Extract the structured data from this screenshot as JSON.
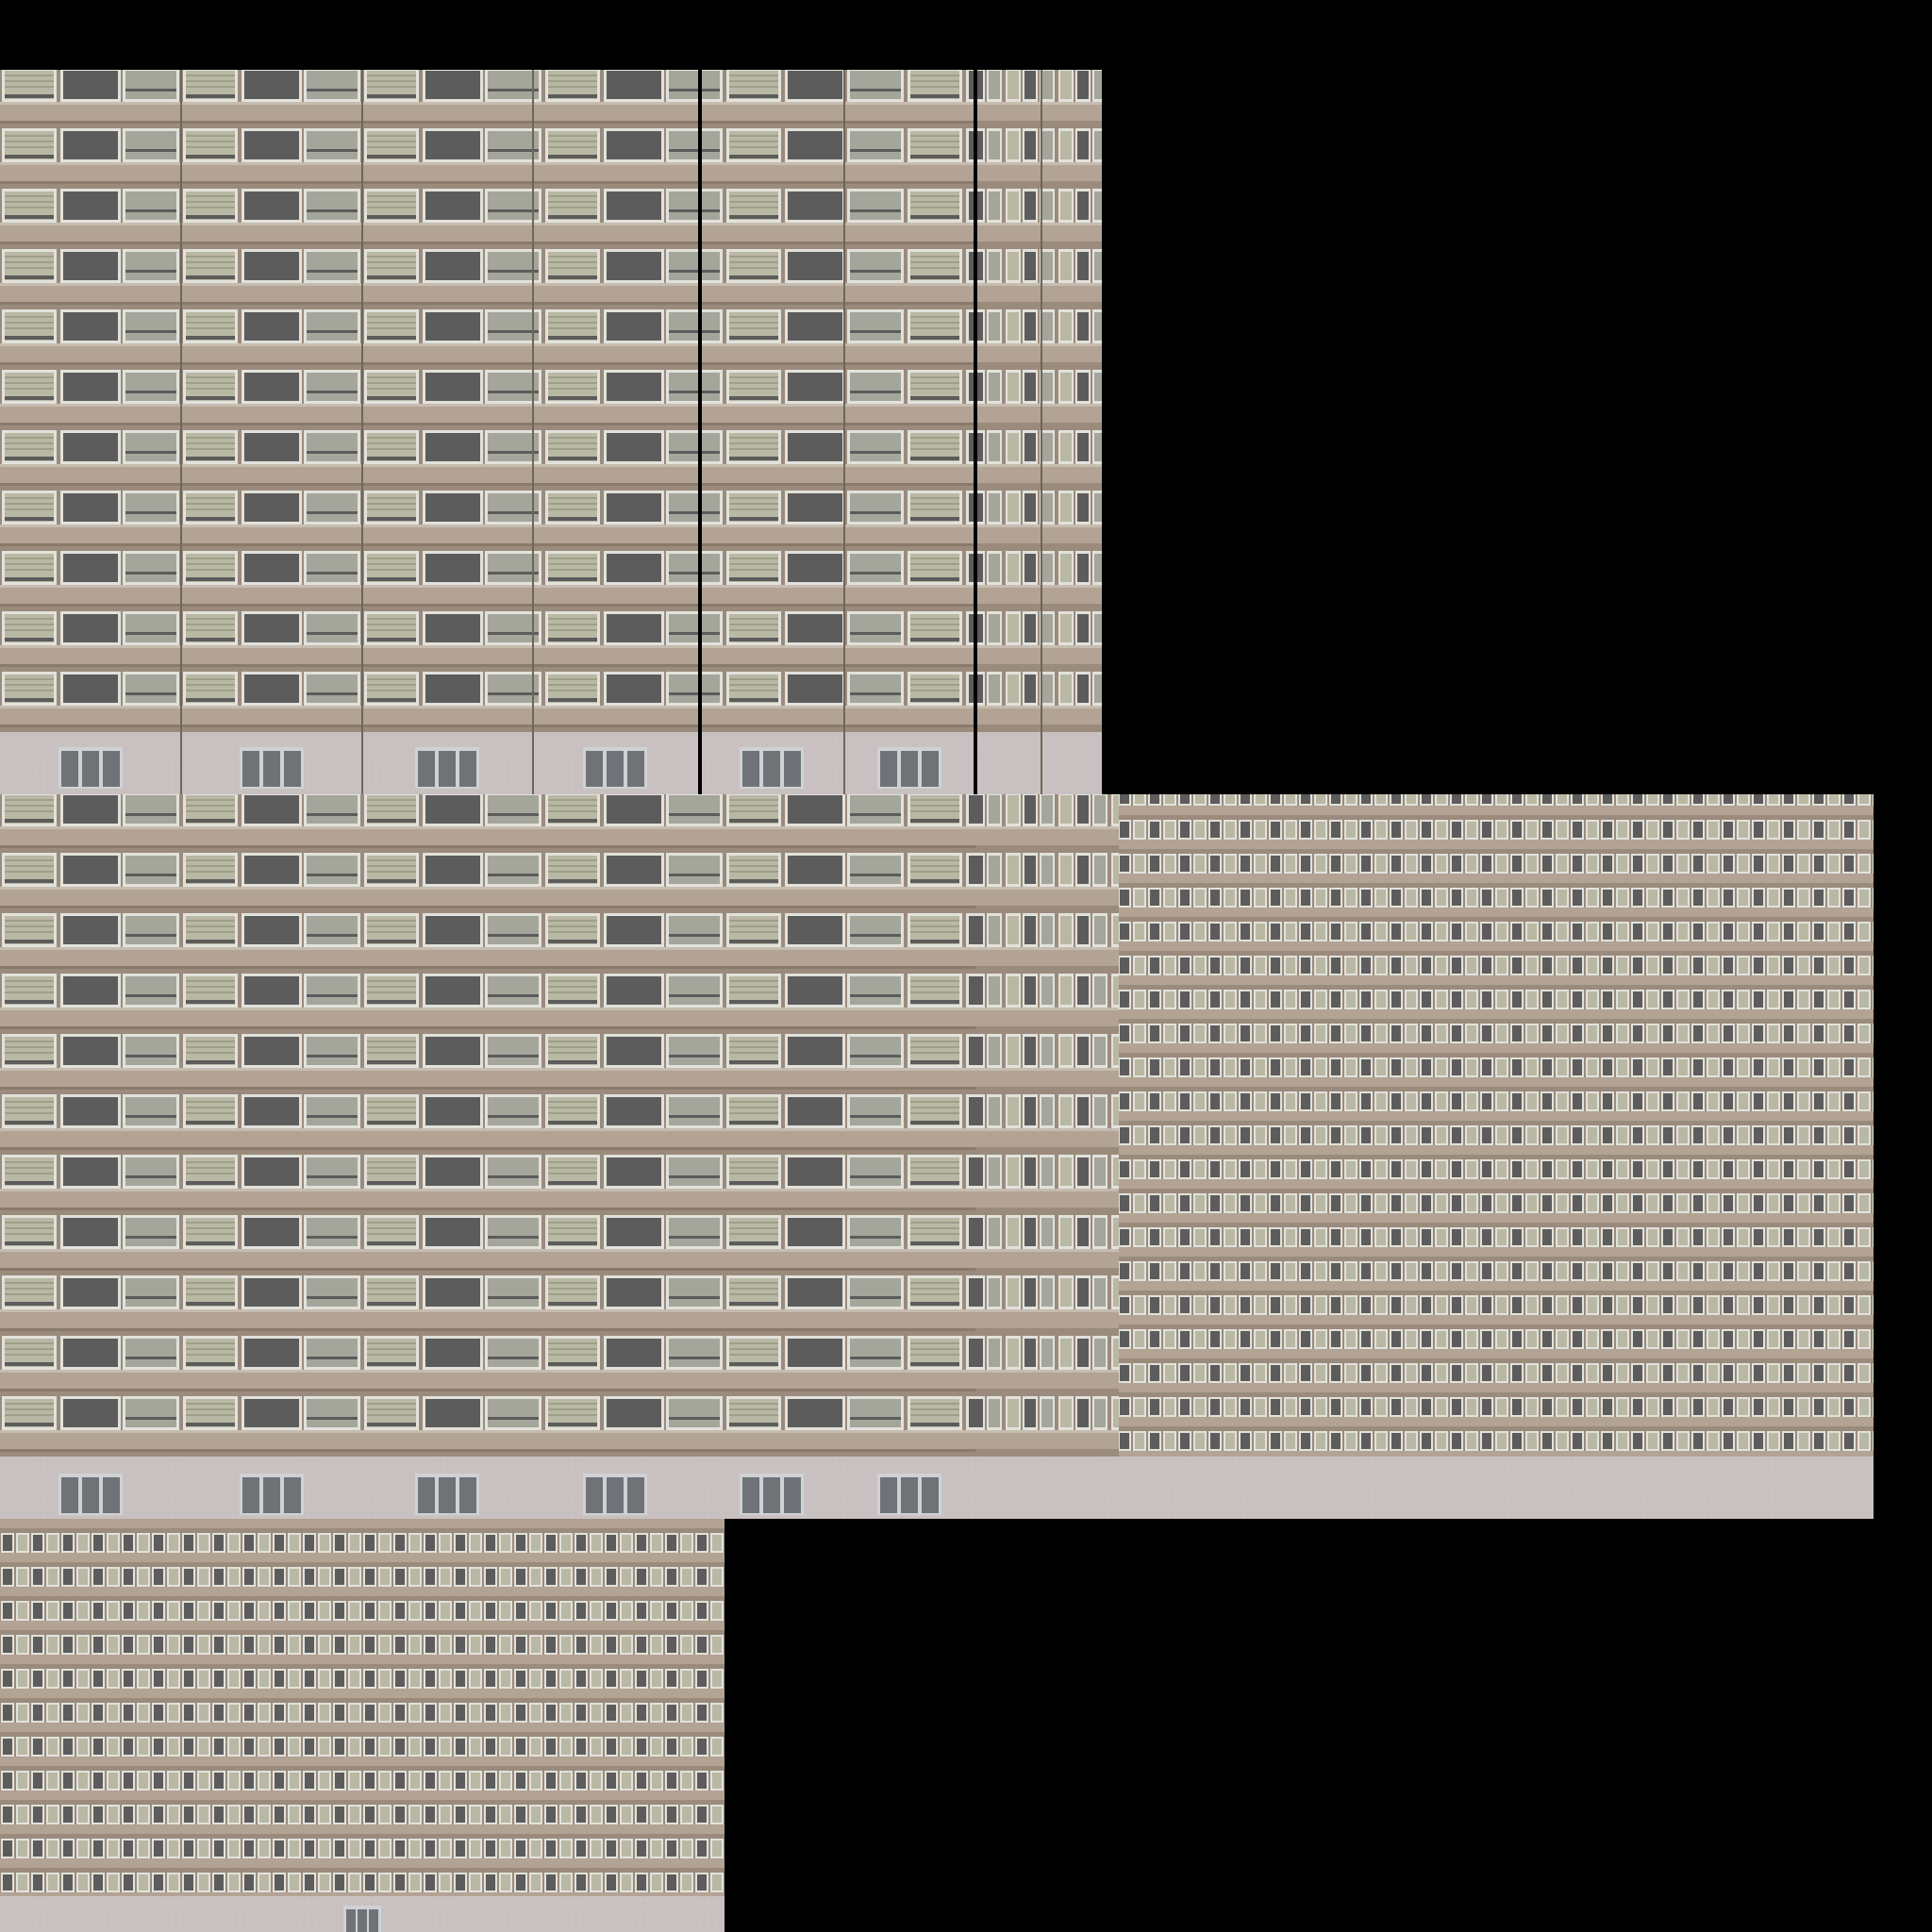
{
  "texture_atlas": {
    "background_color": "#000000",
    "colors": {
      "brick": "#9b8b7c",
      "brick_line": "#8a7a6b",
      "spandrel": "#b3a394",
      "ledge": "#c6bcb0",
      "window_frame": "#e2e2dc",
      "blind": "#b9b8a4",
      "blind_slat": "#9f9e88",
      "glass_dark": "#5c5c5c",
      "glass_light": "#a4a69c",
      "ground_floor": "#c9c1c1",
      "door_frame": "#cfd2d4",
      "door_glass": "#6f7378"
    },
    "panels": [
      {
        "name": "facade-panel-top",
        "floors": 11,
        "has_ground_floor": true,
        "entrance_doors": 6,
        "detail_level": "high"
      },
      {
        "name": "facade-panel-middle",
        "floors": 11,
        "has_ground_floor": true,
        "entrance_doors": 6,
        "detail_level": "high-to-low"
      },
      {
        "name": "facade-panel-bottom",
        "floors": 11,
        "has_ground_floor": true,
        "entrance_doors": 1,
        "detail_level": "low"
      }
    ]
  }
}
